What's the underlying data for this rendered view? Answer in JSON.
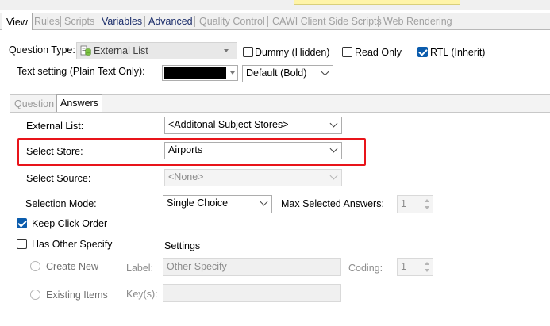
{
  "colors": {
    "highlight": "#e8141a",
    "accent": "#0b5cad",
    "tab_strong": "#1c2e6b"
  },
  "tabs": [
    {
      "label": "View",
      "state": "active"
    },
    {
      "label": "Rules",
      "state": "disabled"
    },
    {
      "label": "Scripts",
      "state": "disabled"
    },
    {
      "label": "Variables",
      "state": "strong"
    },
    {
      "label": "Advanced",
      "state": "strong"
    },
    {
      "label": "Quality Control",
      "state": "disabled"
    },
    {
      "label": "CAWI Client Side Scripts",
      "state": "disabled"
    },
    {
      "label": "Web Rendering",
      "state": "disabled"
    }
  ],
  "question_type": {
    "label": "Question Type:",
    "value": "External List",
    "icon": "database-list-icon"
  },
  "checks_top": {
    "dummy": {
      "label": "Dummy (Hidden)",
      "checked": false
    },
    "read_only": {
      "label": "Read Only",
      "checked": false
    },
    "rtl": {
      "label": "RTL (Inherit)",
      "checked": true
    }
  },
  "text_setting": {
    "label": "Text setting (Plain Text Only):",
    "style_value": "Default (Bold)"
  },
  "sub_tabs": [
    {
      "label": "Question",
      "state": "disabled"
    },
    {
      "label": "Answers",
      "state": "active"
    }
  ],
  "answers": {
    "external_list": {
      "label": "External List:",
      "value": "<Additonal Subject Stores>"
    },
    "select_store": {
      "label": "Select Store:",
      "value": "Airports"
    },
    "select_source": {
      "label": "Select Source:",
      "value": "<None>"
    },
    "selection_mode": {
      "label": "Selection Mode:",
      "value": "Single Choice"
    },
    "max_selected": {
      "label": "Max Selected Answers:",
      "value": "1"
    },
    "keep_click_order": {
      "label": "Keep Click Order",
      "checked": true
    },
    "has_other_specify": {
      "label": "Has Other Specify",
      "checked": false
    },
    "settings_label": "Settings",
    "create_new": {
      "label": "Create New"
    },
    "existing_items": {
      "label": "Existing Items"
    },
    "label_field": {
      "label": "Label:",
      "value": "Other Specify"
    },
    "coding_field": {
      "label": "Coding:",
      "value": "1"
    },
    "keys_field": {
      "label": "Key(s):",
      "value": ""
    }
  }
}
